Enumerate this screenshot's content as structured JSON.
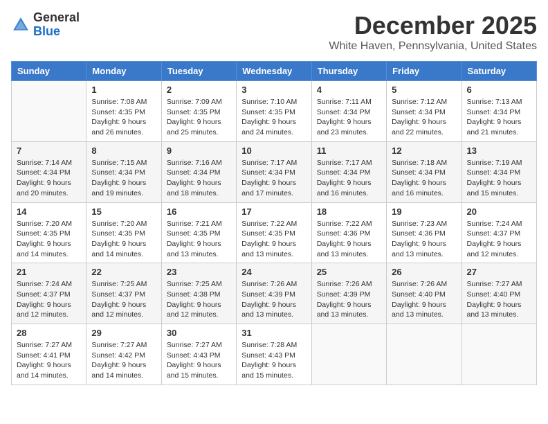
{
  "logo": {
    "general": "General",
    "blue": "Blue"
  },
  "header": {
    "month": "December 2025",
    "location": "White Haven, Pennsylvania, United States"
  },
  "weekdays": [
    "Sunday",
    "Monday",
    "Tuesday",
    "Wednesday",
    "Thursday",
    "Friday",
    "Saturday"
  ],
  "weeks": [
    [
      {
        "day": "",
        "sunrise": "",
        "sunset": "",
        "daylight": ""
      },
      {
        "day": "1",
        "sunrise": "7:08 AM",
        "sunset": "4:35 PM",
        "daylight": "9 hours and 26 minutes."
      },
      {
        "day": "2",
        "sunrise": "7:09 AM",
        "sunset": "4:35 PM",
        "daylight": "9 hours and 25 minutes."
      },
      {
        "day": "3",
        "sunrise": "7:10 AM",
        "sunset": "4:35 PM",
        "daylight": "9 hours and 24 minutes."
      },
      {
        "day": "4",
        "sunrise": "7:11 AM",
        "sunset": "4:34 PM",
        "daylight": "9 hours and 23 minutes."
      },
      {
        "day": "5",
        "sunrise": "7:12 AM",
        "sunset": "4:34 PM",
        "daylight": "9 hours and 22 minutes."
      },
      {
        "day": "6",
        "sunrise": "7:13 AM",
        "sunset": "4:34 PM",
        "daylight": "9 hours and 21 minutes."
      }
    ],
    [
      {
        "day": "7",
        "sunrise": "7:14 AM",
        "sunset": "4:34 PM",
        "daylight": "9 hours and 20 minutes."
      },
      {
        "day": "8",
        "sunrise": "7:15 AM",
        "sunset": "4:34 PM",
        "daylight": "9 hours and 19 minutes."
      },
      {
        "day": "9",
        "sunrise": "7:16 AM",
        "sunset": "4:34 PM",
        "daylight": "9 hours and 18 minutes."
      },
      {
        "day": "10",
        "sunrise": "7:17 AM",
        "sunset": "4:34 PM",
        "daylight": "9 hours and 17 minutes."
      },
      {
        "day": "11",
        "sunrise": "7:17 AM",
        "sunset": "4:34 PM",
        "daylight": "9 hours and 16 minutes."
      },
      {
        "day": "12",
        "sunrise": "7:18 AM",
        "sunset": "4:34 PM",
        "daylight": "9 hours and 16 minutes."
      },
      {
        "day": "13",
        "sunrise": "7:19 AM",
        "sunset": "4:34 PM",
        "daylight": "9 hours and 15 minutes."
      }
    ],
    [
      {
        "day": "14",
        "sunrise": "7:20 AM",
        "sunset": "4:35 PM",
        "daylight": "9 hours and 14 minutes."
      },
      {
        "day": "15",
        "sunrise": "7:20 AM",
        "sunset": "4:35 PM",
        "daylight": "9 hours and 14 minutes."
      },
      {
        "day": "16",
        "sunrise": "7:21 AM",
        "sunset": "4:35 PM",
        "daylight": "9 hours and 13 minutes."
      },
      {
        "day": "17",
        "sunrise": "7:22 AM",
        "sunset": "4:35 PM",
        "daylight": "9 hours and 13 minutes."
      },
      {
        "day": "18",
        "sunrise": "7:22 AM",
        "sunset": "4:36 PM",
        "daylight": "9 hours and 13 minutes."
      },
      {
        "day": "19",
        "sunrise": "7:23 AM",
        "sunset": "4:36 PM",
        "daylight": "9 hours and 13 minutes."
      },
      {
        "day": "20",
        "sunrise": "7:24 AM",
        "sunset": "4:37 PM",
        "daylight": "9 hours and 12 minutes."
      }
    ],
    [
      {
        "day": "21",
        "sunrise": "7:24 AM",
        "sunset": "4:37 PM",
        "daylight": "9 hours and 12 minutes."
      },
      {
        "day": "22",
        "sunrise": "7:25 AM",
        "sunset": "4:37 PM",
        "daylight": "9 hours and 12 minutes."
      },
      {
        "day": "23",
        "sunrise": "7:25 AM",
        "sunset": "4:38 PM",
        "daylight": "9 hours and 12 minutes."
      },
      {
        "day": "24",
        "sunrise": "7:26 AM",
        "sunset": "4:39 PM",
        "daylight": "9 hours and 13 minutes."
      },
      {
        "day": "25",
        "sunrise": "7:26 AM",
        "sunset": "4:39 PM",
        "daylight": "9 hours and 13 minutes."
      },
      {
        "day": "26",
        "sunrise": "7:26 AM",
        "sunset": "4:40 PM",
        "daylight": "9 hours and 13 minutes."
      },
      {
        "day": "27",
        "sunrise": "7:27 AM",
        "sunset": "4:40 PM",
        "daylight": "9 hours and 13 minutes."
      }
    ],
    [
      {
        "day": "28",
        "sunrise": "7:27 AM",
        "sunset": "4:41 PM",
        "daylight": "9 hours and 14 minutes."
      },
      {
        "day": "29",
        "sunrise": "7:27 AM",
        "sunset": "4:42 PM",
        "daylight": "9 hours and 14 minutes."
      },
      {
        "day": "30",
        "sunrise": "7:27 AM",
        "sunset": "4:43 PM",
        "daylight": "9 hours and 15 minutes."
      },
      {
        "day": "31",
        "sunrise": "7:28 AM",
        "sunset": "4:43 PM",
        "daylight": "9 hours and 15 minutes."
      },
      {
        "day": "",
        "sunrise": "",
        "sunset": "",
        "daylight": ""
      },
      {
        "day": "",
        "sunrise": "",
        "sunset": "",
        "daylight": ""
      },
      {
        "day": "",
        "sunrise": "",
        "sunset": "",
        "daylight": ""
      }
    ]
  ]
}
